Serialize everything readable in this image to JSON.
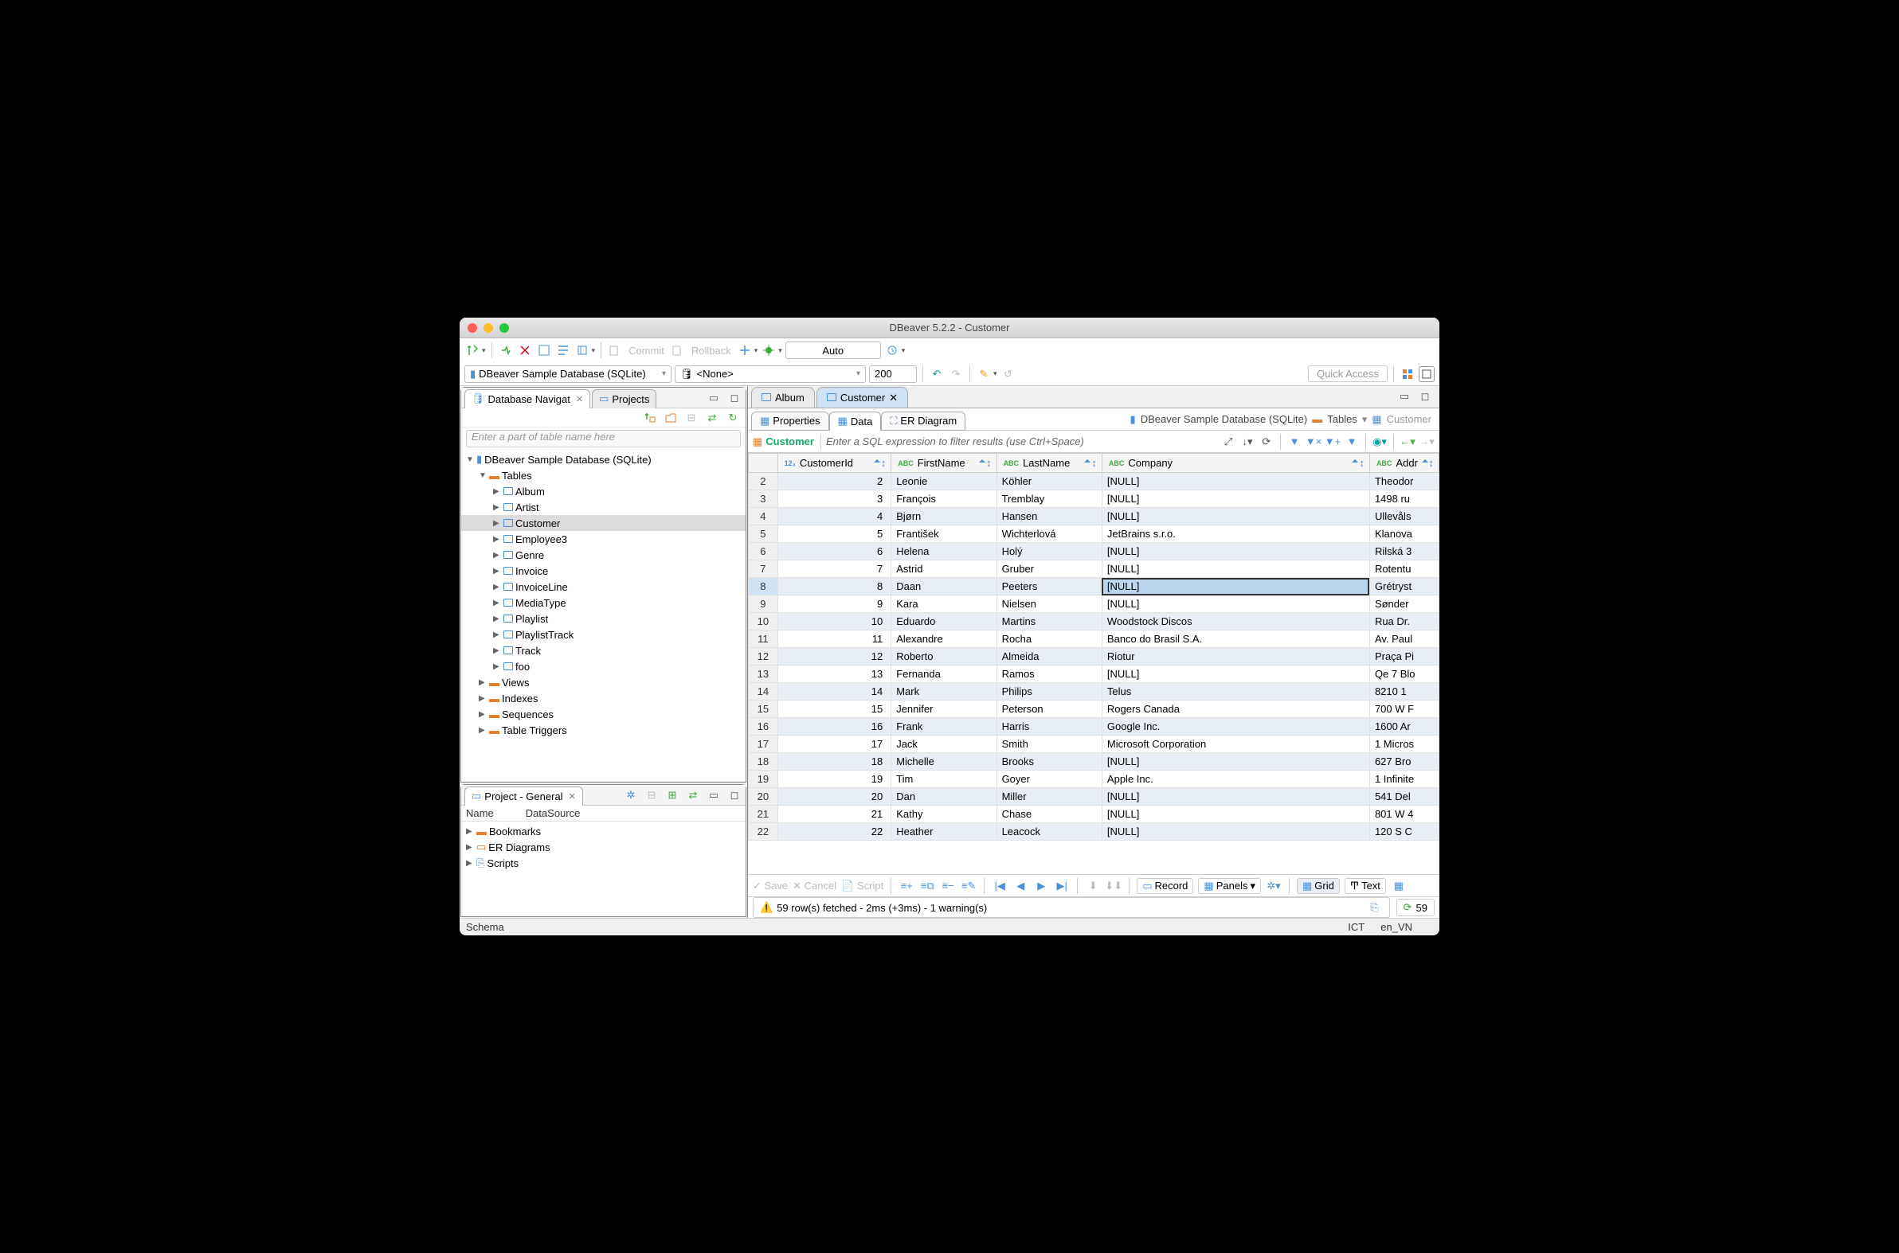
{
  "window_title": "DBeaver 5.2.2 - Customer",
  "toolbar": {
    "commit": "Commit",
    "rollback": "Rollback",
    "mode": "Auto",
    "quick_access": "Quick Access"
  },
  "connection": {
    "datasource": "DBeaver Sample Database (SQLite)",
    "database": "<None>",
    "limit": "200"
  },
  "left": {
    "nav_tab": "Database Navigat",
    "projects_tab": "Projects",
    "filter_placeholder": "Enter a part of table name here",
    "tree": {
      "root": "DBeaver Sample Database (SQLite)",
      "tables_label": "Tables",
      "tables": [
        "Album",
        "Artist",
        "Customer",
        "Employee3",
        "Genre",
        "Invoice",
        "InvoiceLine",
        "MediaType",
        "Playlist",
        "PlaylistTrack",
        "Track",
        "foo"
      ],
      "views": "Views",
      "indexes": "Indexes",
      "sequences": "Sequences",
      "triggers": "Table Triggers"
    },
    "project_panel": "Project - General",
    "proj_cols": {
      "name": "Name",
      "ds": "DataSource"
    },
    "proj_items": [
      "Bookmarks",
      "ER Diagrams",
      "Scripts"
    ]
  },
  "editor": {
    "tabs": [
      "Album",
      "Customer"
    ],
    "subtabs": {
      "properties": "Properties",
      "data": "Data",
      "er": "ER Diagram"
    },
    "breadcrumb": {
      "ds": "DBeaver Sample Database (SQLite)",
      "tables": "Tables",
      "table": "Customer"
    },
    "filter_label": "Customer",
    "sql_placeholder": "Enter a SQL expression to filter results (use Ctrl+Space)",
    "columns": [
      "CustomerId",
      "FirstName",
      "LastName",
      "Company",
      "Addr"
    ],
    "rows": [
      {
        "n": 2,
        "id": "2",
        "fn": "Leonie",
        "ln": "Köhler",
        "co": "[NULL]",
        "ad": "Theodor"
      },
      {
        "n": 3,
        "id": "3",
        "fn": "François",
        "ln": "Tremblay",
        "co": "[NULL]",
        "ad": "1498 ru"
      },
      {
        "n": 4,
        "id": "4",
        "fn": "Bjørn",
        "ln": "Hansen",
        "co": "[NULL]",
        "ad": "Ullevåls"
      },
      {
        "n": 5,
        "id": "5",
        "fn": "František",
        "ln": "Wichterlová",
        "co": "JetBrains s.r.o.",
        "ad": "Klanova"
      },
      {
        "n": 6,
        "id": "6",
        "fn": "Helena",
        "ln": "Holý",
        "co": "[NULL]",
        "ad": "Rilská 3"
      },
      {
        "n": 7,
        "id": "7",
        "fn": "Astrid",
        "ln": "Gruber",
        "co": "[NULL]",
        "ad": "Rotentu"
      },
      {
        "n": 8,
        "id": "8",
        "fn": "Daan",
        "ln": "Peeters",
        "co": "[NULL]",
        "ad": "Grétryst"
      },
      {
        "n": 9,
        "id": "9",
        "fn": "Kara",
        "ln": "Nielsen",
        "co": "[NULL]",
        "ad": "Sønder"
      },
      {
        "n": 10,
        "id": "10",
        "fn": "Eduardo",
        "ln": "Martins",
        "co": "Woodstock Discos",
        "ad": "Rua Dr."
      },
      {
        "n": 11,
        "id": "11",
        "fn": "Alexandre",
        "ln": "Rocha",
        "co": "Banco do Brasil S.A.",
        "ad": "Av. Paul"
      },
      {
        "n": 12,
        "id": "12",
        "fn": "Roberto",
        "ln": "Almeida",
        "co": "Riotur",
        "ad": "Praça Pi"
      },
      {
        "n": 13,
        "id": "13",
        "fn": "Fernanda",
        "ln": "Ramos",
        "co": "[NULL]",
        "ad": "Qe 7 Blo"
      },
      {
        "n": 14,
        "id": "14",
        "fn": "Mark",
        "ln": "Philips",
        "co": "Telus",
        "ad": "8210 1"
      },
      {
        "n": 15,
        "id": "15",
        "fn": "Jennifer",
        "ln": "Peterson",
        "co": "Rogers Canada",
        "ad": "700 W F"
      },
      {
        "n": 16,
        "id": "16",
        "fn": "Frank",
        "ln": "Harris",
        "co": "Google Inc.",
        "ad": "1600 Ar"
      },
      {
        "n": 17,
        "id": "17",
        "fn": "Jack",
        "ln": "Smith",
        "co": "Microsoft Corporation",
        "ad": "1 Micros"
      },
      {
        "n": 18,
        "id": "18",
        "fn": "Michelle",
        "ln": "Brooks",
        "co": "[NULL]",
        "ad": "627 Bro"
      },
      {
        "n": 19,
        "id": "19",
        "fn": "Tim",
        "ln": "Goyer",
        "co": "Apple Inc.",
        "ad": "1 Infinite"
      },
      {
        "n": 20,
        "id": "20",
        "fn": "Dan",
        "ln": "Miller",
        "co": "[NULL]",
        "ad": "541 Del"
      },
      {
        "n": 21,
        "id": "21",
        "fn": "Kathy",
        "ln": "Chase",
        "co": "[NULL]",
        "ad": "801 W 4"
      },
      {
        "n": 22,
        "id": "22",
        "fn": "Heather",
        "ln": "Leacock",
        "co": "[NULL]",
        "ad": "120 S C"
      }
    ],
    "selected_row": 8,
    "selected_col": "co",
    "bottom": {
      "save": "Save",
      "cancel": "Cancel",
      "script": "Script",
      "record": "Record",
      "panels": "Panels",
      "grid": "Grid",
      "text": "Text"
    },
    "status_msg": "59 row(s) fetched - 2ms (+3ms) - 1 warning(s)",
    "rowcount": "59"
  },
  "footer": {
    "schema": "Schema",
    "tz": "ICT",
    "locale": "en_VN"
  }
}
